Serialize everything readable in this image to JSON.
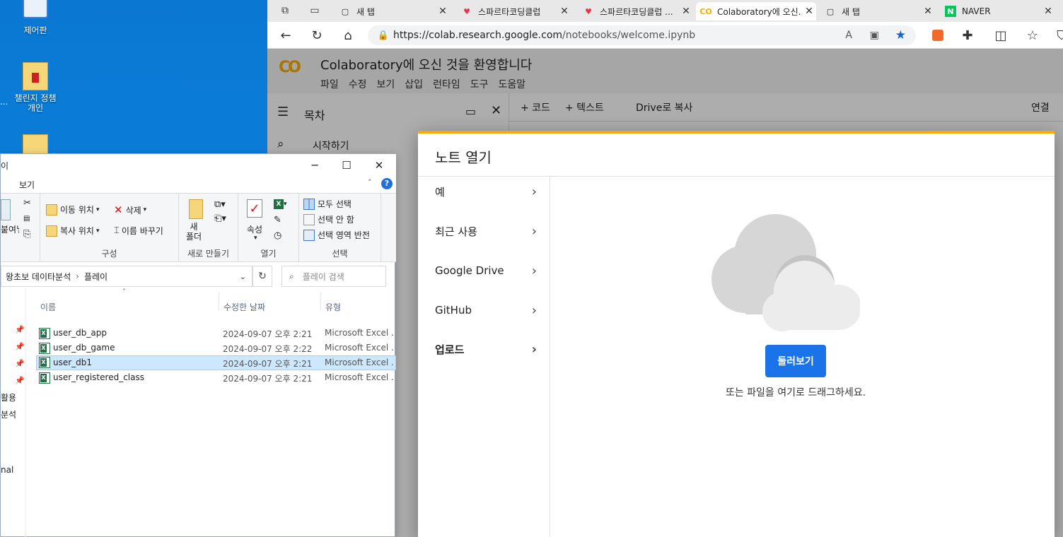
{
  "desktop": {
    "icons": [
      {
        "label": "제어판"
      },
      {
        "label": "챌린지 정챔\n개인"
      },
      {
        "label": "..."
      }
    ]
  },
  "browser": {
    "tabs": [
      {
        "label": "새 탭"
      },
      {
        "label": "스파르타코딩클럽"
      },
      {
        "label": "스파르타코딩클럽 ..."
      },
      {
        "label": "Colaboratory에 오신..."
      },
      {
        "label": "새 탭"
      },
      {
        "label": "NAVER"
      }
    ],
    "url_host": "https://colab.research.google.com",
    "url_path": "/notebooks/welcome.ipynb"
  },
  "colab": {
    "title": "Colaboratory에 오신 것을 환영합니다",
    "menu": [
      "파일",
      "수정",
      "보기",
      "삽입",
      "런타임",
      "도구",
      "도움말"
    ],
    "toolbar": {
      "add_code": "+ 코드",
      "add_text": "+ 텍스트",
      "copy_drive": "Drive로 복사",
      "connect": "연결"
    },
    "sidebar": {
      "toc": "목차",
      "item1": "시작하기"
    }
  },
  "modal": {
    "title": "노트 열기",
    "nav": [
      "예",
      "최근 사용",
      "Google Drive",
      "GitHub",
      "업로드"
    ],
    "browse": "둘러보기",
    "drag_hint": "또는 파일을 여기로 드래그하세요.",
    "accent_color": "#1a73e8",
    "progress_color": "#f9ab00"
  },
  "explorer": {
    "title_fragment": "이",
    "tab": "보기",
    "ribbon": {
      "paste": "붙여넣기",
      "move_to": "이동 위치",
      "copy_to": "복사 위치",
      "delete": "삭제",
      "rename": "이름 바꾸기",
      "organize": "구성",
      "new_folder": "새\n폴더",
      "new": "새로 만들기",
      "properties": "속성",
      "open": "열기",
      "select_all": "모두 선택",
      "select_none": "선택 안 함",
      "invert_selection": "선택 영역 반전",
      "select": "선택"
    },
    "breadcrumb": [
      "왕초보 데이타분석",
      "플레이"
    ],
    "search_placeholder": "플레이 검색",
    "columns": {
      "name": "이름",
      "date": "수정한 날짜",
      "type": "유형"
    },
    "files": [
      {
        "name": "user_db_app",
        "date": "2024-09-07 오후 2:21",
        "type": "Microsoft Excel ..."
      },
      {
        "name": "user_db_game",
        "date": "2024-09-07 오후 2:22",
        "type": "Microsoft Excel ..."
      },
      {
        "name": "user_db1",
        "date": "2024-09-07 오후 2:21",
        "type": "Microsoft Excel ..."
      },
      {
        "name": "user_registered_class",
        "date": "2024-09-07 오후 2:21",
        "type": "Microsoft Excel ..."
      }
    ],
    "navpane": [
      "활용",
      "분석",
      "nal"
    ]
  }
}
